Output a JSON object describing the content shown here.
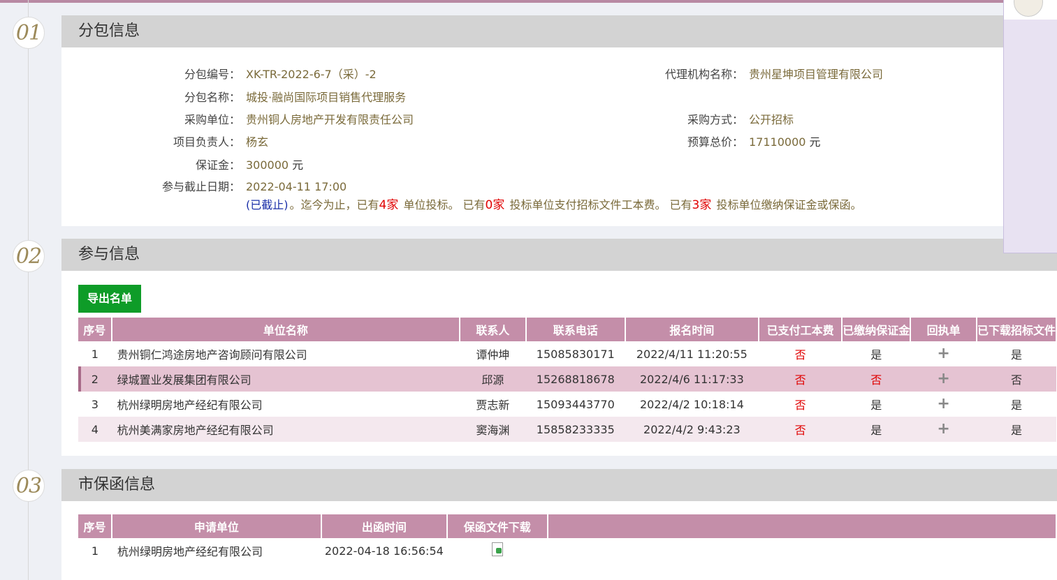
{
  "sections": [
    {
      "number": "01",
      "title": "分包信息"
    },
    {
      "number": "02",
      "title": "参与信息"
    },
    {
      "number": "03",
      "title": "市保函信息"
    }
  ],
  "package": {
    "code_label": "分包编号：",
    "code": "XK-TR-2022-6-7（采）-2",
    "agency_label": "代理机构名称：",
    "agency": "贵州星坤项目管理有限公司",
    "name_label": "分包名称：",
    "name": "城投·融尚国际项目销售代理服务",
    "buyer_label": "采购单位：",
    "buyer": "贵州铜人房地产开发有限责任公司",
    "method_label": "采购方式：",
    "method": "公开招标",
    "manager_label": "项目负责人：",
    "manager": "杨玄",
    "budget_label": "预算总价：",
    "budget": "17110000",
    "budget_unit": "元",
    "deposit_label": "保证金：",
    "deposit": "300000",
    "deposit_unit": "元",
    "deadline_label": "参与截止日期：",
    "deadline": "2022-04-11 17:00",
    "status_closed": "(已截止)",
    "summary_1": "。迄今为止，已有",
    "bid_count": "4家",
    "summary_2": "单位投标。 已有",
    "paid_count": "0家",
    "summary_3": "投标单位支付招标文件工本费。 已有",
    "deposit_count": "3家",
    "summary_4": "投标单位缴纳保证金或保函。"
  },
  "participants": {
    "export_button": "导出名单",
    "headers": [
      "序号",
      "单位名称",
      "联系人",
      "联系电话",
      "报名时间",
      "已支付工本费",
      "已缴纳保证金",
      "回执单",
      "已下载招标文件"
    ],
    "rows": [
      {
        "no": "1",
        "company": "贵州铜仁鸿途房地产咨询顾问有限公司",
        "contact": "谭仲坤",
        "phone": "15085830171",
        "time": "2022/4/11 11:20:55",
        "fee": "否",
        "deposit": "是",
        "receipt": "+",
        "downloaded": "是"
      },
      {
        "no": "2",
        "company": "绿城置业发展集团有限公司",
        "contact": "邱源",
        "phone": "15268818678",
        "time": "2022/4/6 11:17:33",
        "fee": "否",
        "deposit": "否",
        "receipt": "+",
        "downloaded": "否"
      },
      {
        "no": "3",
        "company": "杭州绿明房地产经纪有限公司",
        "contact": "贾志新",
        "phone": "15093443770",
        "time": "2022/4/2 10:18:14",
        "fee": "否",
        "deposit": "是",
        "receipt": "+",
        "downloaded": "是"
      },
      {
        "no": "4",
        "company": "杭州美满家房地产经纪有限公司",
        "contact": "窦海渊",
        "phone": "15858233335",
        "time": "2022/4/2 9:43:23",
        "fee": "否",
        "deposit": "是",
        "receipt": "+",
        "downloaded": "是"
      }
    ]
  },
  "guarantees": {
    "headers": [
      "序号",
      "申请单位",
      "出函时间",
      "保函文件下载"
    ],
    "rows": [
      {
        "no": "1",
        "company": "杭州绿明房地产经纪有限公司",
        "time": "2022-04-18 16:56:54",
        "file_icon": "download-file-icon"
      }
    ]
  },
  "colors": {
    "accent": "#c48ea9",
    "export_green": "#0e9c28",
    "negative_red": "#e00000",
    "header_gray": "#d3d3d3"
  }
}
